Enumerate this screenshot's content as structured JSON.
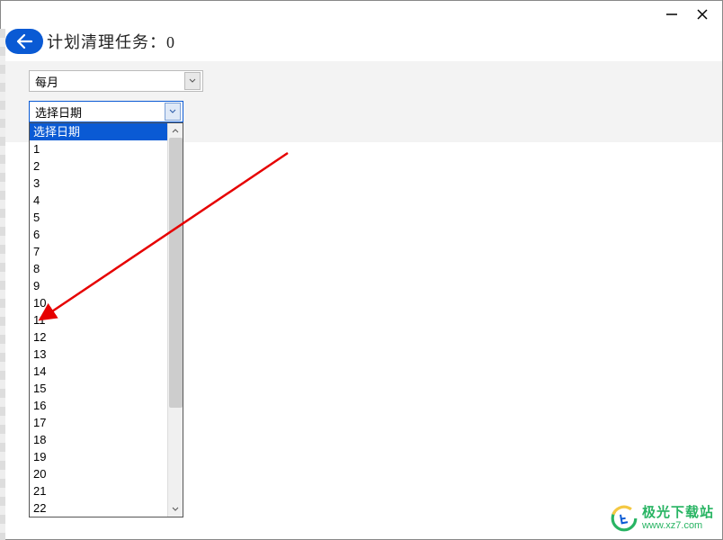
{
  "header": {
    "title": "计划清理任务：0"
  },
  "controls": {
    "frequency": {
      "selected": "每月"
    },
    "date_select": {
      "selected": "选择日期",
      "options": [
        "选择日期",
        "1",
        "2",
        "3",
        "4",
        "5",
        "6",
        "7",
        "8",
        "9",
        "10",
        "11",
        "12",
        "13",
        "14",
        "15",
        "16",
        "17",
        "18",
        "19",
        "20",
        "21",
        "22"
      ]
    }
  },
  "watermark": {
    "line1": "极光下载站",
    "line2": "www.xz7.com"
  }
}
